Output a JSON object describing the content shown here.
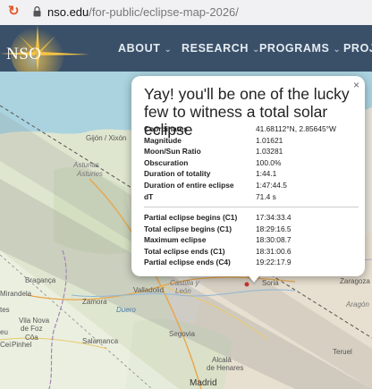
{
  "browser": {
    "host": "nso.edu",
    "path": "/for-public/eclipse-map-2026/"
  },
  "site": {
    "logo_text": "NSO",
    "nav": [
      {
        "label": "ABOUT"
      },
      {
        "label": "RESEARCH"
      },
      {
        "label": "PROGRAMS"
      },
      {
        "label": "PROJE"
      }
    ]
  },
  "map": {
    "places": {
      "gijon": "Gijón / Xixón",
      "asturias": "Asturias",
      "astur_sub": "Asturies",
      "braganca": "Bragança",
      "mirandela": "Mirandela",
      "zamora": "Zamora",
      "valladolid": "Valladolid",
      "castilla": "Castilla y",
      "leon_reg": "León",
      "soria": "Soria",
      "zaragoza": "Zaragoza",
      "aragon": "Aragón",
      "vila_nova": "Vila Nova",
      "de_foz": "de Foz",
      "coa": "Côa",
      "pinhel": "Pinhel",
      "salamanca": "Salamanca",
      "segovia": "Segovia",
      "alcala": "Alcalá",
      "de_henares": "de Henares",
      "madrid": "Madrid",
      "teruel": "Teruel",
      "duero": "Duero",
      "nso_label": "NSO",
      "tes": "tes",
      "coa_short": "Coa",
      "eu": "eu",
      "cei": "Cei"
    }
  },
  "popup": {
    "close_label": "×",
    "title": "Yay! you'll be one of the lucky few to witness a total solar eclipse",
    "details": [
      {
        "label": "Coordinates",
        "value": "41.68112°N, 2.85645°W"
      },
      {
        "label": "Magnitude",
        "value": "1.01621"
      },
      {
        "label": "Moon/Sun Ratio",
        "value": "1.03281"
      },
      {
        "label": "Obscuration",
        "value": "100.0%"
      },
      {
        "label": "Duration of totality",
        "value": "1:44.1"
      },
      {
        "label": "Duration of entire eclipse",
        "value": "1:47:44.5"
      },
      {
        "label": "dT",
        "value": "71.4 s"
      }
    ],
    "times": [
      {
        "label": "Partial eclipse begins (C1)",
        "value": "17:34:33.4"
      },
      {
        "label": "Total eclipse begins (C1)",
        "value": "18:29:16.5"
      },
      {
        "label": "Maximum eclipse",
        "value": "18:30:08.7"
      },
      {
        "label": "Total eclipse ends (C1)",
        "value": "18:31:00.6"
      },
      {
        "label": "Partial eclipse ends (C4)",
        "value": "19:22:17.9"
      }
    ]
  }
}
